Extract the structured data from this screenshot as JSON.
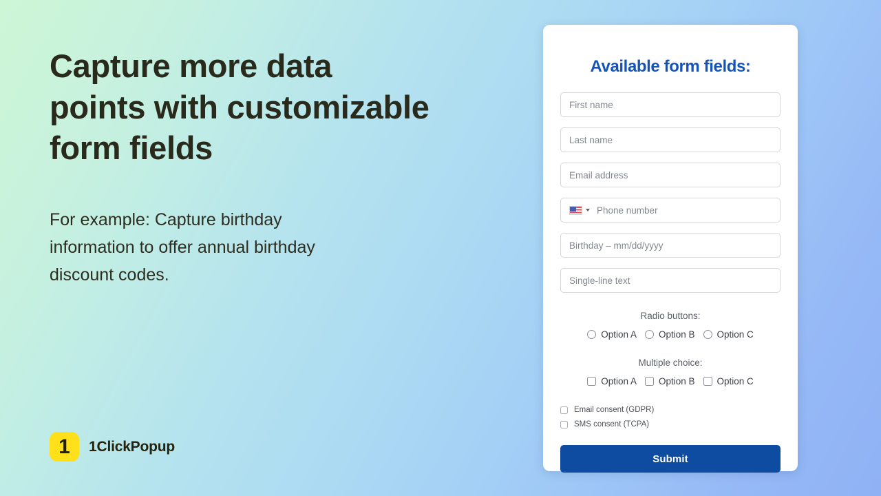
{
  "background": {
    "gradient_from": "#cdf6d6",
    "gradient_to": "#8fb2f5"
  },
  "left_panel": {
    "headline": "Capture more data\npoints with customizable\nform fields",
    "subcopy": "For example: Capture birthday\ninformation to offer annual birthday\ndiscount codes.",
    "headline_color": "#292a1b"
  },
  "logo": {
    "mark_text": "1",
    "mark_color": "#ffe01b",
    "brand_name": "1ClickPopup"
  },
  "form_card": {
    "title": "Available form fields:",
    "title_color": "#1454b8",
    "fields": [
      {
        "placeholder": "First name",
        "name": "first-name"
      },
      {
        "placeholder": "Last name",
        "name": "last-name"
      },
      {
        "placeholder": "Email address",
        "name": "email-address"
      },
      {
        "placeholder": "Birthday – mm/dd/yyyy",
        "name": "birthday"
      },
      {
        "placeholder": "Single-line text",
        "name": "single-line-text"
      }
    ],
    "phone_field": {
      "placeholder": "Phone number",
      "country_flag": "us-flag-icon",
      "caret": "chevron-down-icon"
    },
    "radio_group": {
      "label": "Radio buttons:",
      "options": [
        "Option A",
        "Option B",
        "Option C"
      ]
    },
    "checkbox_group": {
      "label": "Multiple choice:",
      "options": [
        "Option A",
        "Option B",
        "Option C"
      ]
    },
    "consents": [
      "Email consent (GDPR)",
      "SMS consent (TCPA)"
    ],
    "submit_label": "Submit",
    "submit_color": "#0e4ca1"
  }
}
